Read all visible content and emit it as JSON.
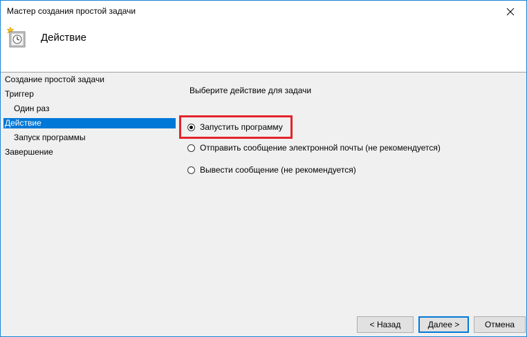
{
  "window": {
    "title": "Мастер создания простой задачи"
  },
  "header": {
    "title": "Действие",
    "icon": "task-scheduler-icon"
  },
  "nav": {
    "items": [
      {
        "label": "Создание простой задачи",
        "level": 0,
        "selected": false
      },
      {
        "label": "Триггер",
        "level": 0,
        "selected": false
      },
      {
        "label": "Один раз",
        "level": 1,
        "selected": false
      },
      {
        "label": "Действие",
        "level": 0,
        "selected": true
      },
      {
        "label": "Запуск программы",
        "level": 1,
        "selected": false
      },
      {
        "label": "Завершение",
        "level": 0,
        "selected": false
      }
    ]
  },
  "panel": {
    "heading": "Выберите действие для задачи",
    "options": [
      {
        "label": "Запустить программу",
        "checked": true
      },
      {
        "label": "Отправить сообщение электронной почты (не рекомендуется)",
        "checked": false
      },
      {
        "label": "Вывести сообщение (не рекомендуется)",
        "checked": false
      }
    ]
  },
  "buttons": {
    "back": "< Назад",
    "next": "Далее >",
    "cancel": "Отмена"
  },
  "colors": {
    "selection": "#0078d7",
    "highlight": "#e3242b",
    "window_border": "#1883d7"
  }
}
